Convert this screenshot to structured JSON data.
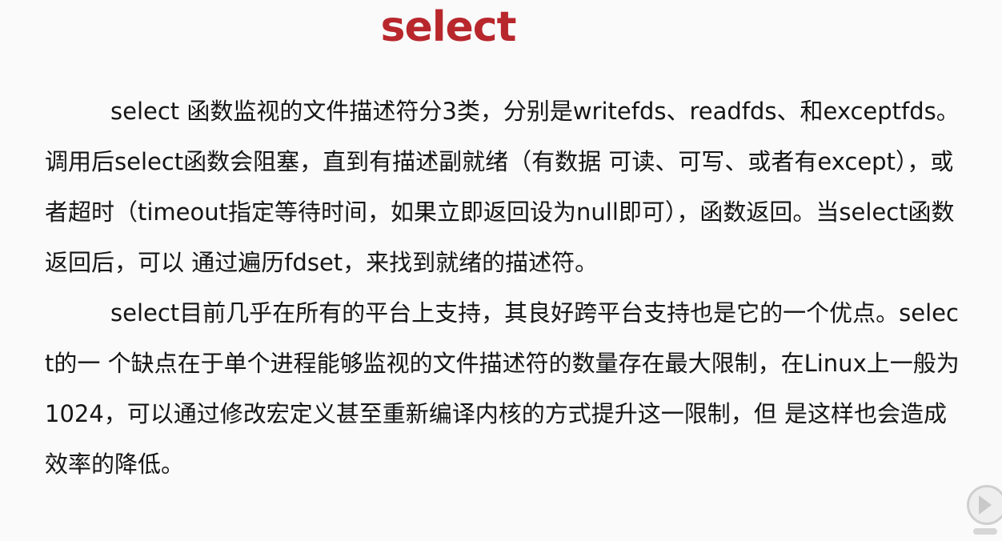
{
  "slide": {
    "title": "select",
    "paragraphs": [
      "select 函数监视的文件描述符分3类，分别是writefds、readfds、和exceptfds。调用后select函数会阻塞，直到有描述副就绪（有数据 可读、可写、或者有except），或者超时（timeout指定等待时间，如果立即返回设为null即可），函数返回。当select函数返回后，可以 通过遍历fdset，来找到就绪的描述符。",
      "select目前几乎在所有的平台上支持，其良好跨平台支持也是它的一个优点。select的一 个缺点在于单个进程能够监视的文件描述符的数量存在最大限制，在Linux上一般为1024，可以通过修改宏定义甚至重新编译内核的方式提升这一限制，但 是这样也会造成效率的降低。"
    ]
  },
  "controls": {
    "play_icon": "play-icon"
  },
  "colors": {
    "title": "#b8272c",
    "text": "#161616",
    "background": "#fafafa"
  }
}
